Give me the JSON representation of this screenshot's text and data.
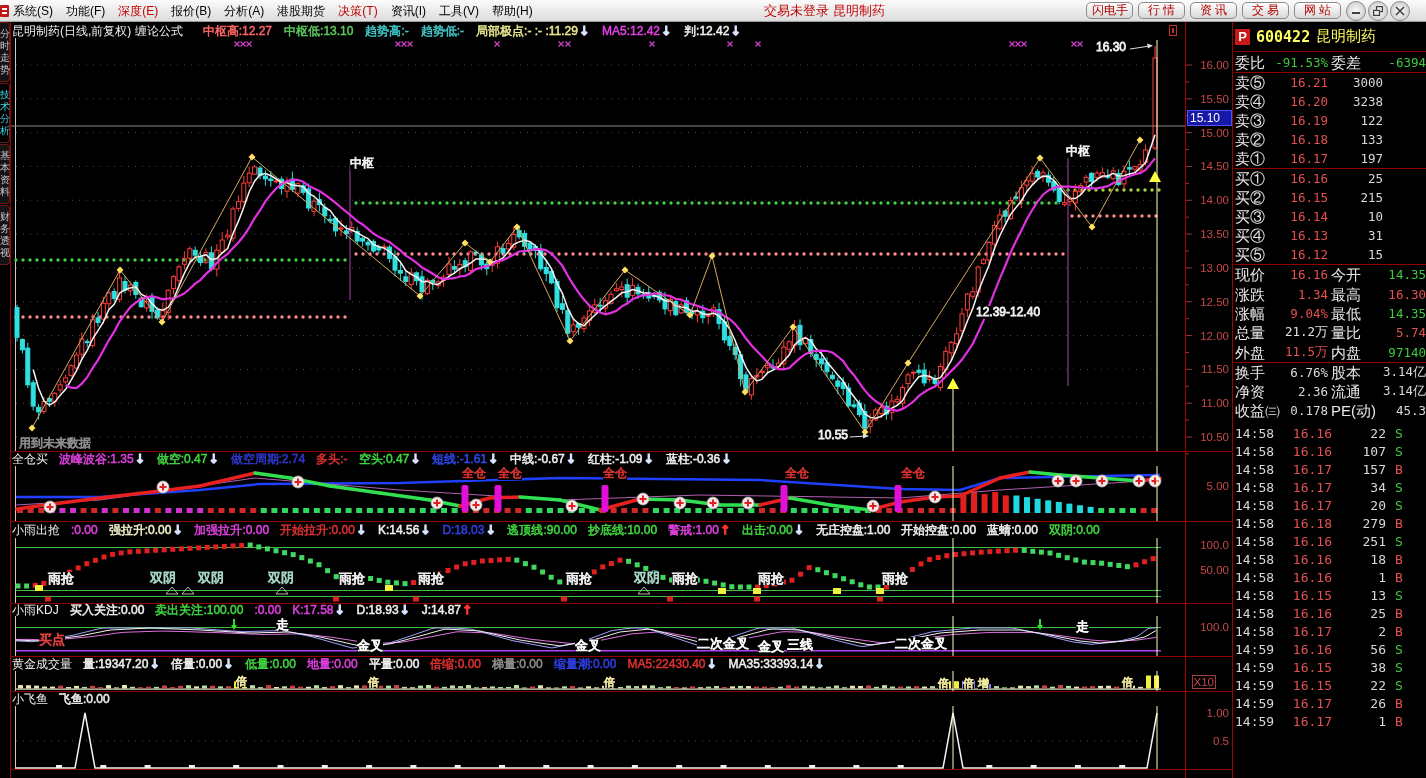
{
  "menu": {
    "items": [
      {
        "label": "系统(S)",
        "highlighted": false
      },
      {
        "label": "功能(F)",
        "highlighted": false
      },
      {
        "label": "深度(E)",
        "highlighted": true
      },
      {
        "label": "报价(B)",
        "highlighted": false
      },
      {
        "label": "分析(A)",
        "highlighted": false
      },
      {
        "label": "港股期货",
        "highlighted": false
      },
      {
        "label": "决策(T)",
        "highlighted": true
      },
      {
        "label": "资讯(I)",
        "highlighted": false
      },
      {
        "label": "工具(V)",
        "highlighted": false
      },
      {
        "label": "帮助(H)",
        "highlighted": false
      }
    ],
    "status": "交易未登录 昆明制药",
    "buttons": [
      "闪电手",
      "行 情",
      "资 讯",
      "交 易",
      "网 站"
    ]
  },
  "side_tabs": [
    {
      "label": "分时走势",
      "selected": false
    },
    {
      "label": "技术分析",
      "selected": true
    },
    {
      "label": "基本资料",
      "selected": false
    },
    {
      "label": "财务透视",
      "selected": false
    }
  ],
  "price_chart": {
    "title": "昆明制药(日线,前复权) 缠论公式",
    "indicators": [
      {
        "text": "中枢高:12.27",
        "color": "#ff6464"
      },
      {
        "text": "中枢低:13.10",
        "color": "#5cc85c"
      },
      {
        "text": "趋势高:-",
        "color": "#40c8c8"
      },
      {
        "text": "趋势低:-",
        "color": "#40c8c8"
      },
      {
        "text": "局部极点:- :- :11.29",
        "color": "#e8e890",
        "arrow": {
          "text": "↓",
          "color": "#d8e4ff"
        }
      },
      {
        "text": "MA5:12.42",
        "color": "#e040e0",
        "arrow": {
          "text": "↓",
          "color": "#d8e4ff"
        }
      },
      {
        "text": "判:12.42",
        "color": "#f0f0f0",
        "arrow": {
          "text": "↓",
          "color": "#d8e4ff"
        }
      }
    ],
    "labels": [
      "中枢",
      "中枢",
      "16.30",
      "10.55",
      "12.39-12.40"
    ],
    "note": "用到未来数据"
  },
  "price_axis": {
    "ticks": [
      "16.00",
      "15.50",
      "15.00",
      "14.50",
      "14.00",
      "13.50",
      "13.00",
      "12.50",
      "12.00",
      "11.50",
      "11.00",
      "10.50"
    ],
    "tag": "15.10"
  },
  "panels": [
    {
      "title": "全仓买",
      "indicators": [
        {
          "text": "波峰波谷:1.35",
          "color": "#e040e0",
          "arrow": {
            "text": "↓",
            "color": "#d8e4ff"
          }
        },
        {
          "text": "做空:0.47",
          "color": "#40d840",
          "arrow": {
            "text": "↓",
            "color": "#d8e4ff"
          }
        },
        {
          "text": "做空周期:2.74",
          "color": "#3038d0"
        },
        {
          "text": "多头:-",
          "color": "#e03030"
        },
        {
          "text": "空头:0.47",
          "color": "#40d840",
          "arrow": {
            "text": "↓",
            "color": "#d8e4ff"
          }
        },
        {
          "text": "短线:-1.61",
          "color": "#3048f0",
          "arrow": {
            "text": "↓",
            "color": "#d8e4ff"
          }
        },
        {
          "text": "中线:-0.67",
          "color": "#f0f0f0",
          "arrow": {
            "text": "↓",
            "color": "#d8e4ff"
          }
        },
        {
          "text": "红柱:-1.09",
          "color": "#f0f0f0",
          "arrow": {
            "text": "↓",
            "color": "#d8e4ff"
          }
        },
        {
          "text": "蓝柱:-0.36",
          "color": "#f0f0f0",
          "arrow": {
            "text": "↓",
            "color": "#d8e4ff"
          }
        }
      ],
      "labels": [
        {
          "text": "全仓"
        },
        {
          "text": "全仓"
        },
        {
          "text": "全仓"
        },
        {
          "text": "全仓"
        },
        {
          "text": "全仓"
        }
      ],
      "ticks": [
        "5.00"
      ]
    },
    {
      "title": "小雨出抢",
      "indicators": [
        {
          "text": ":0.00",
          "color": "#e040e0"
        },
        {
          "text": "强拉升:0.00",
          "color": "#f0f0c8",
          "arrow": {
            "text": "↓",
            "color": "#d8e4ff"
          }
        },
        {
          "text": "加强拉升:0.00",
          "color": "#e040e0"
        },
        {
          "text": "开始拉升:0.00",
          "color": "#e03030",
          "arrow": {
            "text": "↓",
            "color": "#d8e4ff"
          }
        },
        {
          "text": "K:14.56",
          "color": "#f0f0f0",
          "arrow": {
            "text": "↓",
            "color": "#d8e4ff"
          }
        },
        {
          "text": "D:18.03",
          "color": "#3040e8",
          "arrow": {
            "text": "↓",
            "color": "#d8e4ff"
          }
        },
        {
          "text": "逃顶线:90.00",
          "color": "#40d840"
        },
        {
          "text": "抄底线:10.00",
          "color": "#40d840"
        },
        {
          "text": "警戒:1.00",
          "color": "#e040e0",
          "arrow": {
            "text": "↑",
            "color": "#ff3030"
          }
        },
        {
          "text": "出击:0.00",
          "color": "#40d840",
          "arrow": {
            "text": "↓",
            "color": "#d8e4ff"
          }
        },
        {
          "text": "无庄控盘:1.00",
          "color": "#f0f0f0"
        },
        {
          "text": "开始控盘:0.00",
          "color": "#f0f0f0"
        },
        {
          "text": "蓝蜻:0.00",
          "color": "#f0f0f0"
        },
        {
          "text": "双阴:0.00",
          "color": "#40d840"
        }
      ],
      "labels": [
        {
          "text": "雨抢",
          "color": "#f0f0f0"
        },
        {
          "text": "双阴",
          "color": "#a8d8c8"
        },
        {
          "text": "双阴",
          "color": "#a8d8c8"
        },
        {
          "text": "双阴",
          "color": "#a8d8c8"
        },
        {
          "text": "雨抢",
          "color": "#f0f0f0"
        },
        {
          "text": "雨抢",
          "color": "#f0f0f0"
        },
        {
          "text": "雨抢",
          "color": "#f0f0f0"
        },
        {
          "text": "双阴",
          "color": "#a8d8c8"
        },
        {
          "text": "雨抢",
          "color": "#f0f0f0"
        },
        {
          "text": "雨抢",
          "color": "#f0f0f0"
        },
        {
          "text": "雨抢",
          "color": "#f0f0f0"
        }
      ],
      "ticks": [
        "100.0",
        "50.00"
      ]
    },
    {
      "title": "小雨KDJ",
      "indicators": [
        {
          "text": "买入关注:0.00",
          "color": "#f0f0f0"
        },
        {
          "text": "卖出关注:100.00",
          "color": "#40d840"
        },
        {
          "text": ":0.00",
          "color": "#e040e0"
        },
        {
          "text": "K:17.58",
          "color": "#e040e0",
          "arrow": {
            "text": "↓",
            "color": "#d8e4ff"
          }
        },
        {
          "text": "D:18.93",
          "color": "#f0f0f0",
          "arrow": {
            "text": "↓",
            "color": "#d8e4ff"
          }
        },
        {
          "text": "J:14.87",
          "color": "#f0f0f0",
          "arrow": {
            "text": "↑",
            "color": "#ff3030"
          }
        }
      ],
      "labels": [
        {
          "text": "买点",
          "color": "#e04040"
        },
        {
          "text": "走",
          "color": "#ffffff"
        },
        {
          "text": "金叉",
          "color": "#ffffff"
        },
        {
          "text": "金叉",
          "color": "#ffffff"
        },
        {
          "text": "二次金叉",
          "color": "#ffffff"
        },
        {
          "text": "金叉",
          "color": "#ffffff"
        },
        {
          "text": "三线",
          "color": "#ffffff"
        },
        {
          "text": "二次金叉",
          "color": "#ffffff"
        },
        {
          "text": "走",
          "color": "#ffffff"
        }
      ],
      "ticks": [
        "100.0"
      ]
    },
    {
      "title": "黄金成交量",
      "indicators": [
        {
          "text": "量:19347.20",
          "color": "#f0f0f0",
          "arrow": {
            "text": "↓",
            "color": "#d8e4ff"
          }
        },
        {
          "text": "倍量:0.00",
          "color": "#f0f0f0",
          "arrow": {
            "text": "↓",
            "color": "#d8e4ff"
          }
        },
        {
          "text": "低量:0.00",
          "color": "#40d840"
        },
        {
          "text": "地量:0.00",
          "color": "#e040e0"
        },
        {
          "text": "平量:0.00",
          "color": "#f0f0f0"
        },
        {
          "text": "倍缩:0.00",
          "color": "#e03030"
        },
        {
          "text": "梯量:0.00",
          "color": "#909090"
        },
        {
          "text": "缩量潮:0.00",
          "color": "#3040e8"
        },
        {
          "text": "MA5:22430.40",
          "color": "#e03030",
          "arrow": {
            "text": "↓",
            "color": "#d8e4ff"
          }
        },
        {
          "text": "MA35:33393.14",
          "color": "#f0f0f0",
          "arrow": {
            "text": "↓",
            "color": "#d8e4ff"
          }
        }
      ],
      "labels": [
        {
          "text": "倍"
        },
        {
          "text": "倍"
        },
        {
          "text": "倍"
        },
        {
          "text": "倍"
        },
        {
          "text": "倍"
        },
        {
          "text": "增"
        },
        {
          "text": "倍"
        }
      ],
      "ticks": [
        "X10"
      ]
    },
    {
      "title": "小飞鱼",
      "indicators": [
        {
          "text": "飞鱼:0.00",
          "color": "#f0f0f0"
        }
      ],
      "ticks": [
        "1.00",
        "0.5"
      ]
    }
  ],
  "quote": {
    "badge": "P",
    "code": "600422",
    "name": "昆明制药",
    "summary": [
      {
        "label": "委比",
        "value": "-91.53%",
        "color": "#40c840"
      },
      {
        "label": "委差",
        "value": "-6394",
        "color": "#40c840"
      }
    ],
    "asks": [
      {
        "label": "卖⑤",
        "price": "16.21",
        "volume": "3000"
      },
      {
        "label": "卖④",
        "price": "16.20",
        "volume": "3238"
      },
      {
        "label": "卖③",
        "price": "16.19",
        "volume": "122"
      },
      {
        "label": "卖②",
        "price": "16.18",
        "volume": "133"
      },
      {
        "label": "卖①",
        "price": "16.17",
        "volume": "197"
      }
    ],
    "bids": [
      {
        "label": "买①",
        "price": "16.16",
        "volume": "25"
      },
      {
        "label": "买②",
        "price": "16.15",
        "volume": "215"
      },
      {
        "label": "买③",
        "price": "16.14",
        "volume": "10"
      },
      {
        "label": "买④",
        "price": "16.13",
        "volume": "31"
      },
      {
        "label": "买⑤",
        "price": "16.12",
        "volume": "15"
      }
    ],
    "stats": [
      [
        {
          "label": "现价",
          "value": "16.16",
          "color": "#e45050"
        },
        {
          "label": "今开",
          "value": "14.35",
          "color": "#40c840"
        }
      ],
      [
        {
          "label": "涨跌",
          "value": "1.34",
          "color": "#e45050"
        },
        {
          "label": "最高",
          "value": "16.30",
          "color": "#e45050"
        }
      ],
      [
        {
          "label": "涨幅",
          "value": "9.04%",
          "color": "#e45050"
        },
        {
          "label": "最低",
          "value": "14.35",
          "color": "#40c840"
        }
      ],
      [
        {
          "label": "总量",
          "value": "21.2万",
          "color": "#e0e0e0"
        },
        {
          "label": "量比",
          "value": "5.74",
          "color": "#e45050"
        }
      ],
      [
        {
          "label": "外盘",
          "value": "11.5万",
          "color": "#e45050"
        },
        {
          "label": "内盘",
          "value": "97140",
          "color": "#40c840"
        }
      ]
    ],
    "fundamentals": [
      [
        {
          "label": "换手",
          "value": "6.76%"
        },
        {
          "label": "股本",
          "value": "3.14亿"
        }
      ],
      [
        {
          "label": "净资",
          "value": "2.36"
        },
        {
          "label": "流通",
          "value": "3.14亿"
        }
      ],
      [
        {
          "label": "收益㈢",
          "value": "0.178"
        },
        {
          "label": "PE(动)",
          "value": "45.3"
        }
      ]
    ],
    "trades": [
      {
        "time": "14:58",
        "price": "16.16",
        "volume": "22",
        "side": "S",
        "kind": "sell"
      },
      {
        "time": "14:58",
        "price": "16.16",
        "volume": "107",
        "side": "S",
        "kind": "sell"
      },
      {
        "time": "14:58",
        "price": "16.17",
        "volume": "157",
        "side": "B",
        "kind": "buy"
      },
      {
        "time": "14:58",
        "price": "16.17",
        "volume": "34",
        "side": "S",
        "kind": "sell"
      },
      {
        "time": "14:58",
        "price": "16.17",
        "volume": "20",
        "side": "S",
        "kind": "sell"
      },
      {
        "time": "14:58",
        "price": "16.18",
        "volume": "279",
        "side": "B",
        "kind": "buy"
      },
      {
        "time": "14:58",
        "price": "16.16",
        "volume": "251",
        "side": "S",
        "kind": "sell"
      },
      {
        "time": "14:58",
        "price": "16.16",
        "volume": "18",
        "side": "B",
        "kind": "buy"
      },
      {
        "time": "14:58",
        "price": "16.16",
        "volume": "1",
        "side": "B",
        "kind": "buy"
      },
      {
        "time": "14:58",
        "price": "16.15",
        "volume": "13",
        "side": "S",
        "kind": "sell"
      },
      {
        "time": "14:58",
        "price": "16.16",
        "volume": "25",
        "side": "B",
        "kind": "buy"
      },
      {
        "time": "14:58",
        "price": "16.17",
        "volume": "2",
        "side": "B",
        "kind": "buy"
      },
      {
        "time": "14:59",
        "price": "16.16",
        "volume": "56",
        "side": "S",
        "kind": "sell"
      },
      {
        "time": "14:59",
        "price": "16.15",
        "volume": "38",
        "side": "S",
        "kind": "sell"
      },
      {
        "time": "14:59",
        "price": "16.15",
        "volume": "22",
        "side": "S",
        "kind": "sell"
      },
      {
        "time": "14:59",
        "price": "16.17",
        "volume": "26",
        "side": "B",
        "kind": "buy"
      },
      {
        "time": "14:59",
        "price": "16.17",
        "volume": "1",
        "side": "B",
        "kind": "buy"
      }
    ]
  }
}
